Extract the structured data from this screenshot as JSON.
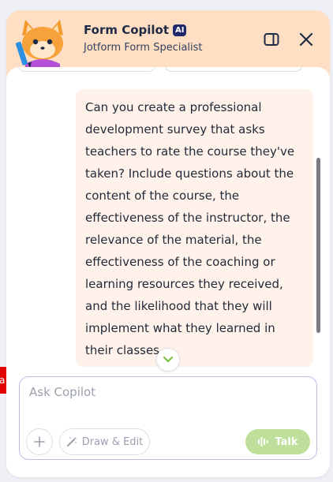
{
  "edge_tag": {
    "label": "a",
    "color": "#e30000"
  },
  "header": {
    "title": "Form Copilot",
    "badge": "AI",
    "subtitle": "Jotform Form Specialist",
    "background": "#ffdfc4",
    "icons": {
      "avatar": "fox-mascot-icon",
      "panel_toggle": "sidebar-toggle-icon",
      "close": "close-icon"
    }
  },
  "chat": {
    "messages": [
      {
        "role": "user",
        "text": "Can you create a professional development survey that asks teachers to rate the course they've taken? Include questions about the content of the course, the effectiveness of the instructor, the relevance of the material, the effectiveness of the coaching or learning resources they received, and the likelihood that they will implement what they learned in their classes."
      }
    ],
    "scroll_down_icon": "chevron-down-icon"
  },
  "composer": {
    "placeholder": "Ask Copilot",
    "value": "",
    "draw_edit_label": "Draw & Edit",
    "talk_label": "Talk",
    "accent": "#bfe09a"
  }
}
